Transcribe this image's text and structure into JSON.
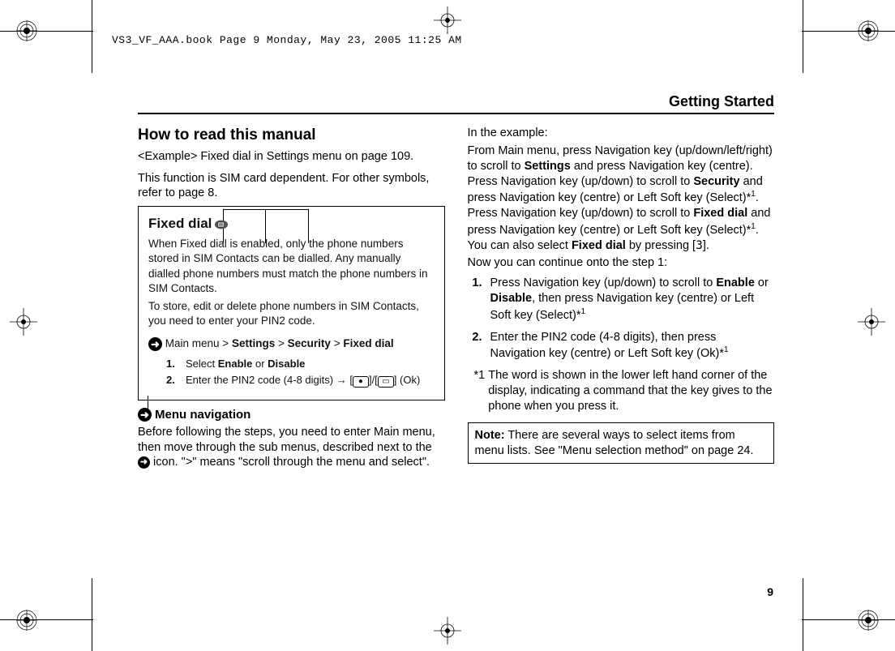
{
  "header_stamp": "VS3_VF_AAA.book  Page 9  Monday, May 23, 2005  11:25 AM",
  "section_header": "Getting Started",
  "page_number": "9",
  "left": {
    "h2": "How to read this manual",
    "example_ref": "<Example> Fixed dial in Settings menu on page 109.",
    "sim_note": "This function is SIM card dependent. For other symbols, refer to page 8.",
    "box": {
      "title": "Fixed dial",
      "body1": "When Fixed dial is enabled, only the phone numbers stored in SIM Contacts can be dialled. Any manually dialled phone numbers must match the phone numbers in SIM Contacts.",
      "body2": "To store, edit or delete phone numbers in SIM Contacts, you need to enter your PIN2 code.",
      "nav_prefix": "Main menu >",
      "nav_settings": "Settings",
      "nav_security": "Security",
      "nav_fixed": "Fixed dial",
      "gt": ">",
      "step1_num": "1.",
      "step1_a": "Select ",
      "step1_enable": "Enable",
      "step1_or": " or ",
      "step1_disable": "Disable",
      "step2_num": "2.",
      "step2_a": "Enter the PIN2 code (4-8 digits) ",
      "step2_ok": " (Ok)"
    },
    "menu_nav_label": "Menu navigation",
    "menu_nav_para_a": "Before following the steps, you need to enter Main menu, then move through the sub menus, described next to the ",
    "menu_nav_para_b": " icon. \">\" means \"scroll through the menu and select\"."
  },
  "right": {
    "intro": "In the example:",
    "para_a": "From Main menu, press Navigation key (up/down/left/right) to scroll to ",
    "b_settings": "Settings",
    "para_b": " and press Navigation key (centre). Press Navigation key (up/down) to scroll to ",
    "b_security": "Security",
    "para_c": " and press Navigation key (centre) or Left Soft key (Select)*",
    "sup1": "1",
    "para_d": ". Press Navigation key (up/down) to scroll to ",
    "b_fixed": "Fixed dial",
    "para_e": " and press Navigation key (centre) or Left Soft key (Select)*",
    "para_f": ". You can also select ",
    "b_fixed2": "Fixed dial",
    "para_g": " by pressing [",
    "key3": "3",
    "para_h": "].",
    "continue": "Now you can continue onto the step 1:",
    "step1_a": "Press Navigation key (up/down) to scroll to ",
    "step1_enable": "Enable",
    "step1_or": " or ",
    "step1_disable": "Disable",
    "step1_b": ", then press Navigation key (centre) or Left Soft key (Select)*",
    "step2_a": "Enter the PIN2 code (4-8 digits), then press Navigation key (centre) or Left Soft key (Ok)*",
    "fn_mark": "*1",
    "fn_text": "The word is shown in the lower left hand corner of the display, indicating a command that the key gives to the phone when you press it.",
    "note_label": "Note:",
    "note_text": "  There are several ways to select items from menu lists. See \"Menu selection method\" on page 24."
  }
}
